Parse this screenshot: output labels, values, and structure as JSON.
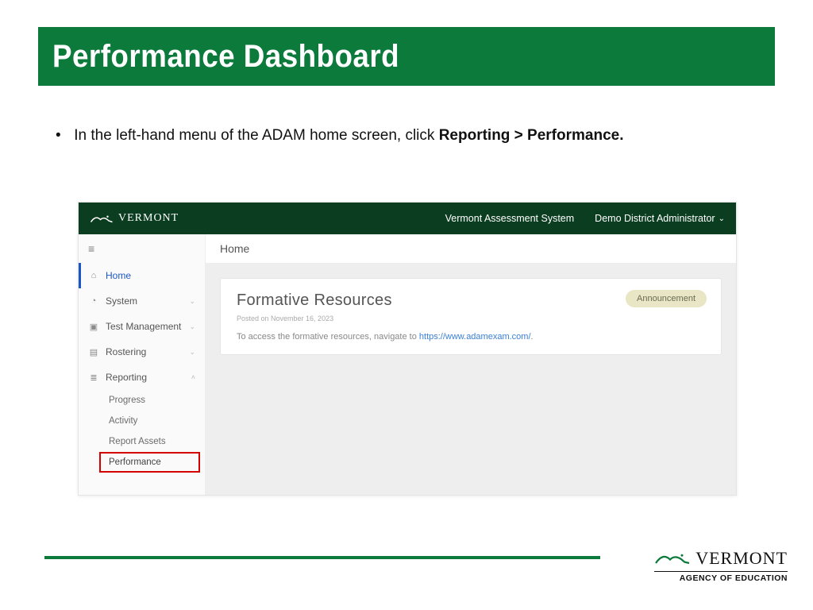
{
  "title": "Performance Dashboard",
  "bullet": {
    "lead": "In the left-hand menu of the ADAM home screen, click ",
    "bold": "Reporting > Performance."
  },
  "screenshot": {
    "brand": "VERMONT",
    "system_label": "Vermont Assessment System",
    "user_label": "Demo District Administrator",
    "page_label": "Home",
    "sidebar": {
      "home": "Home",
      "system": "System",
      "test_mgmt": "Test Management",
      "rostering": "Rostering",
      "reporting": "Reporting",
      "sub": {
        "progress": "Progress",
        "activity": "Activity",
        "report_assets": "Report Assets",
        "performance": "Performance"
      }
    },
    "card": {
      "title": "Formative Resources",
      "posted": "Posted on November 16, 2023",
      "body_lead": "To access the formative resources, navigate to ",
      "body_link": "https://www.adamexam.com/",
      "body_tail": ".",
      "badge": "Announcement"
    }
  },
  "footer": {
    "brand": "VERMONT",
    "agency": "AGENCY OF EDUCATION"
  }
}
